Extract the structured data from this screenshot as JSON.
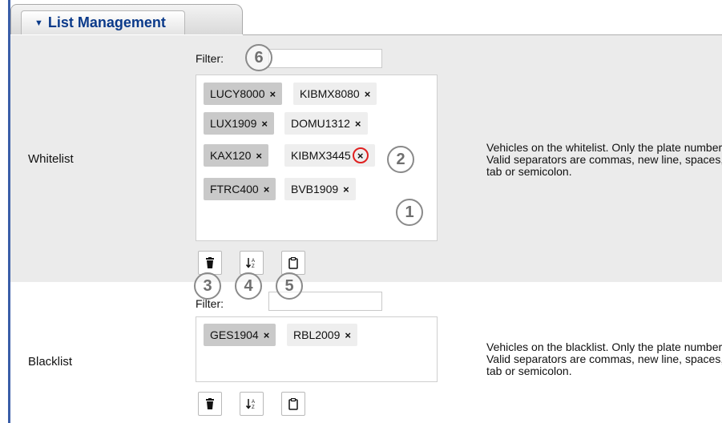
{
  "header": {
    "title": "List Management"
  },
  "whitelist": {
    "label": "Whitelist",
    "filter_label": "Filter:",
    "filter_value": "",
    "tags": [
      "LUCY8000",
      "KIBMX8080",
      "LUX1909",
      "DOMU1312",
      "KAX120",
      "KIBMX3445",
      "FTRC400",
      "BVB1909"
    ],
    "remove_glyph": "×",
    "description": "Vehicles on the whitelist. Only the plate number. Valid separators are commas, new line, spaces, tab or semicolon."
  },
  "blacklist": {
    "label": "Blacklist",
    "filter_label": "Filter:",
    "filter_value": "",
    "tags": [
      "GES1904",
      "RBL2009"
    ],
    "remove_glyph": "×",
    "description": "Vehicles on the blacklist. Only the plate number. Valid separators are commas, new line, spaces, tab or semicolon."
  },
  "toolbar_icons": [
    "trash-icon",
    "sort-icon",
    "clipboard-icon"
  ],
  "callouts": [
    "1",
    "2",
    "3",
    "4",
    "5",
    "6"
  ],
  "colors": {
    "accent": "#0b3a8a",
    "highlight": "#e02020",
    "panel": "#ebebeb"
  }
}
